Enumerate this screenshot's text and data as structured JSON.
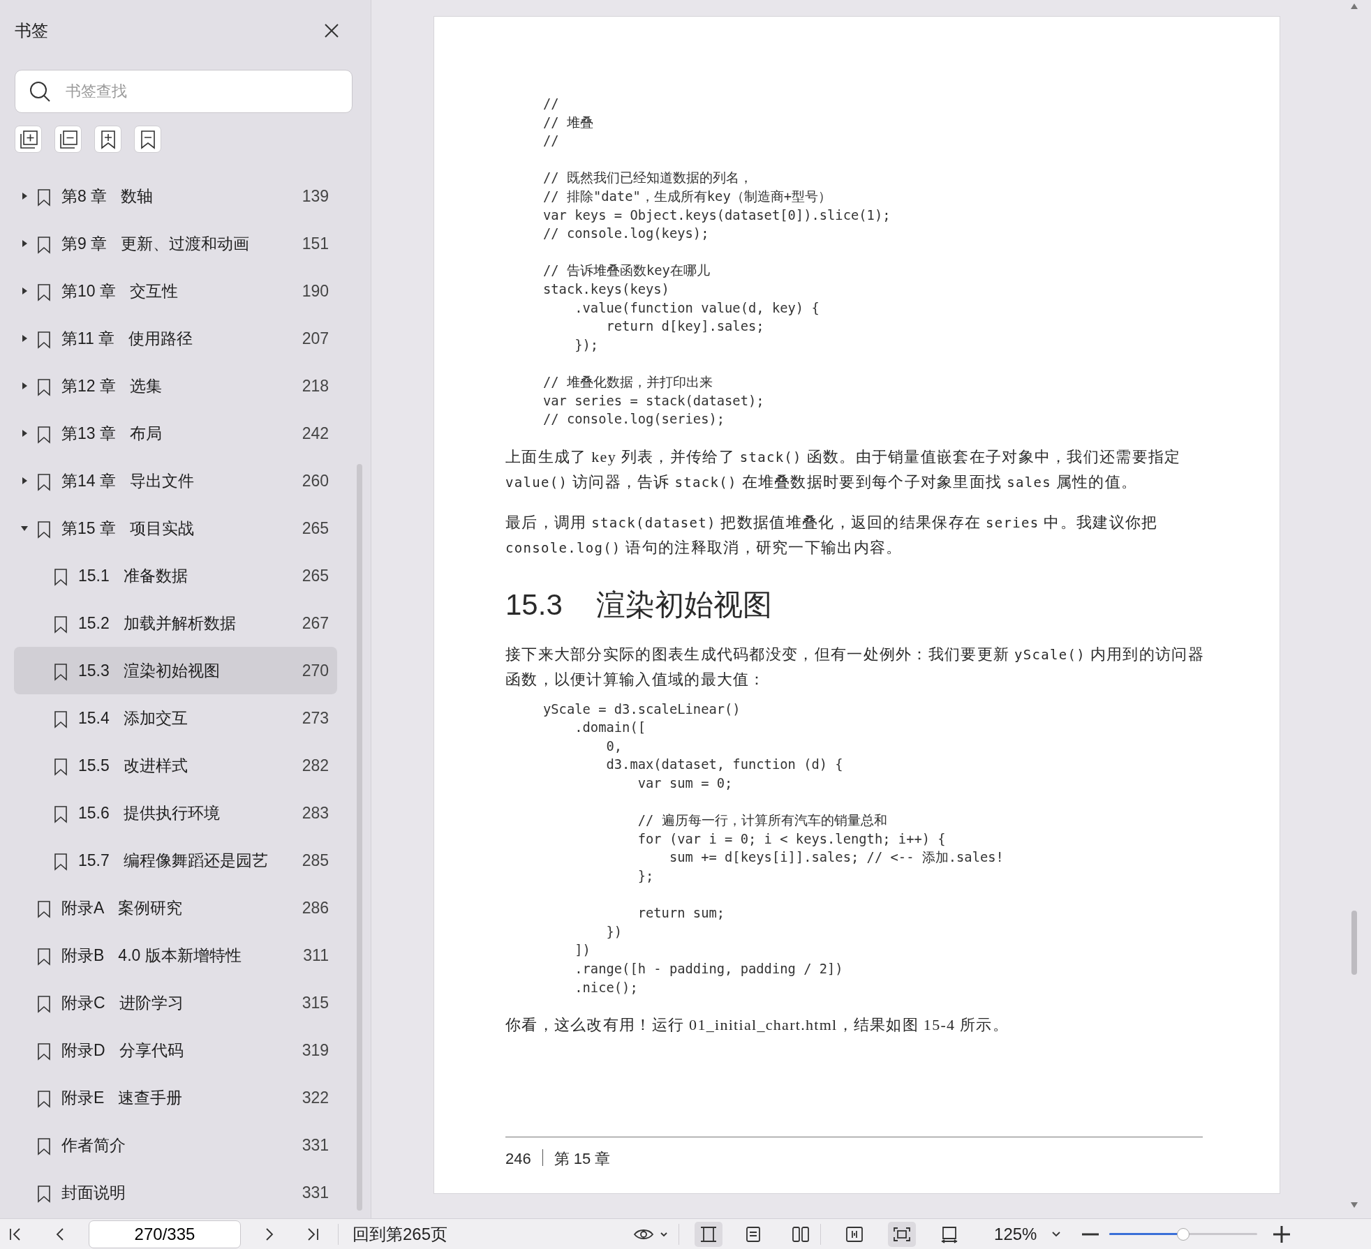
{
  "sidebar": {
    "title": "书签",
    "search": {
      "placeholder": "书签查找"
    },
    "bookmarks": [
      {
        "kind": "folder",
        "expanded": false,
        "selected": false,
        "label": "第8 章",
        "title": "数轴",
        "page": "139"
      },
      {
        "kind": "folder",
        "expanded": false,
        "selected": false,
        "label": "第9 章",
        "title": "更新、过渡和动画",
        "page": "151"
      },
      {
        "kind": "folder",
        "expanded": false,
        "selected": false,
        "label": "第10 章",
        "title": "交互性",
        "page": "190"
      },
      {
        "kind": "folder",
        "expanded": false,
        "selected": false,
        "label": "第11 章",
        "title": "使用路径",
        "page": "207"
      },
      {
        "kind": "folder",
        "expanded": false,
        "selected": false,
        "label": "第12 章",
        "title": "选集",
        "page": "218"
      },
      {
        "kind": "folder",
        "expanded": false,
        "selected": false,
        "label": "第13 章",
        "title": "布局",
        "page": "242"
      },
      {
        "kind": "folder",
        "expanded": false,
        "selected": false,
        "label": "第14 章",
        "title": "导出文件",
        "page": "260"
      },
      {
        "kind": "folder",
        "expanded": true,
        "selected": false,
        "label": "第15 章",
        "title": "项目实战",
        "page": "265",
        "children": [
          {
            "kind": "leaf",
            "selected": false,
            "label": "15.1",
            "title": "准备数据",
            "page": "265"
          },
          {
            "kind": "leaf",
            "selected": false,
            "label": "15.2",
            "title": "加载并解析数据",
            "page": "267"
          },
          {
            "kind": "leaf",
            "selected": true,
            "label": "15.3",
            "title": "渲染初始视图",
            "page": "270"
          },
          {
            "kind": "leaf",
            "selected": false,
            "label": "15.4",
            "title": "添加交互",
            "page": "273"
          },
          {
            "kind": "leaf",
            "selected": false,
            "label": "15.5",
            "title": "改进样式",
            "page": "282"
          },
          {
            "kind": "leaf",
            "selected": false,
            "label": "15.6",
            "title": "提供执行环境",
            "page": "283"
          },
          {
            "kind": "leaf",
            "selected": false,
            "label": "15.7",
            "title": "编程像舞蹈还是园艺",
            "page": "285"
          }
        ]
      },
      {
        "kind": "leaf",
        "selected": false,
        "label": "附录A",
        "title": "案例研究",
        "page": "286"
      },
      {
        "kind": "leaf",
        "selected": false,
        "label": "附录B",
        "title": "4.0 版本新增特性",
        "page": "311"
      },
      {
        "kind": "leaf",
        "selected": false,
        "label": "附录C",
        "title": "进阶学习",
        "page": "315"
      },
      {
        "kind": "leaf",
        "selected": false,
        "label": "附录D",
        "title": "分享代码",
        "page": "319"
      },
      {
        "kind": "leaf",
        "selected": false,
        "label": "附录E",
        "title": "速查手册",
        "page": "322"
      },
      {
        "kind": "leaf",
        "selected": false,
        "label": "作者简介",
        "page": "331"
      },
      {
        "kind": "leaf",
        "selected": false,
        "label": "封面说明",
        "page": "331"
      }
    ]
  },
  "document_page": {
    "blocks": [
      {
        "kind": "code",
        "groups": [
          [
            "//",
            "// 堆叠",
            "//"
          ],
          [
            "// 既然我们已经知道数据的列名，",
            "// 排除\"date\"，生成所有key（制造商+型号）",
            "var keys = Object.keys(dataset[0]).slice(1);",
            "// console.log(keys);"
          ],
          [
            "// 告诉堆叠函数key在哪儿",
            "stack.keys(keys)",
            "    .value(function value(d, key) {",
            "        return d[key].sales;",
            "    });"
          ],
          [
            "// 堆叠化数据，并打印出来",
            "var series = stack(dataset);",
            "// console.log(series);"
          ]
        ]
      },
      {
        "kind": "paragraph",
        "segments": [
          {
            "kind": "text",
            "text": "上面生成了 key 列表，并传给了 "
          },
          {
            "kind": "code",
            "text": "stack()"
          },
          {
            "kind": "text",
            "text": " 函数。由于销量值嵌套在子对象中，我们还需要指定 "
          },
          {
            "kind": "code",
            "text": "value()"
          },
          {
            "kind": "text",
            "text": " 访问器，告诉 "
          },
          {
            "kind": "code",
            "text": "stack()"
          },
          {
            "kind": "text",
            "text": " 在堆叠数据时要到每个子对象里面找 "
          },
          {
            "kind": "code",
            "text": "sales"
          },
          {
            "kind": "text",
            "text": " 属性的值。"
          }
        ]
      },
      {
        "kind": "paragraph",
        "segments": [
          {
            "kind": "text",
            "text": "最后，调用 "
          },
          {
            "kind": "code",
            "text": "stack(dataset)"
          },
          {
            "kind": "text",
            "text": " 把数据值堆叠化，返回的结果保存在 "
          },
          {
            "kind": "code",
            "text": "series"
          },
          {
            "kind": "text",
            "text": " 中。我建议你把 "
          },
          {
            "kind": "code",
            "text": "console.log()"
          },
          {
            "kind": "text",
            "text": " 语句的注释取消，研究一下输出内容。"
          }
        ]
      },
      {
        "kind": "heading",
        "number": "15.3",
        "title": "渲染初始视图"
      },
      {
        "kind": "paragraph",
        "segments": [
          {
            "kind": "text",
            "text": "接下来大部分实际的图表生成代码都没变，但有一处例外：我们要更新 "
          },
          {
            "kind": "code",
            "text": "yScale()"
          },
          {
            "kind": "text",
            "text": " 内用到的访问器函数，以便计算输入值域的最大值："
          }
        ]
      },
      {
        "kind": "code",
        "groups": [
          [
            "yScale = d3.scaleLinear()",
            "    .domain([",
            "        0,",
            "        d3.max(dataset, function (d) {",
            "            var sum = 0;"
          ],
          [
            "            // 遍历每一行，计算所有汽车的销量总和",
            "            for (var i = 0; i < keys.length; i++) {",
            "                sum += d[keys[i]].sales; // <-- 添加.sales!",
            "            };"
          ],
          [
            "            return sum;",
            "        })",
            "    ])",
            "    .range([h - padding, padding / 2])",
            "    .nice();"
          ]
        ]
      },
      {
        "kind": "paragraph",
        "segments": [
          {
            "kind": "text",
            "text": "你看，这么改有用！运行 01_initial_chart.html，结果如图 15-4 所示。"
          }
        ]
      }
    ],
    "footer": {
      "page_number": "246",
      "chapter": "第 15 章"
    }
  },
  "bottom_bar": {
    "page_field": "270/335",
    "back_link": "回到第265页",
    "view_modes": [
      {
        "selected": true
      },
      {
        "selected": false
      },
      {
        "selected": false
      },
      {
        "selected": false
      },
      {
        "selected": true
      },
      {
        "selected": false
      }
    ],
    "zoom": "125%",
    "zoom_slider": {
      "level": 0.5
    }
  }
}
